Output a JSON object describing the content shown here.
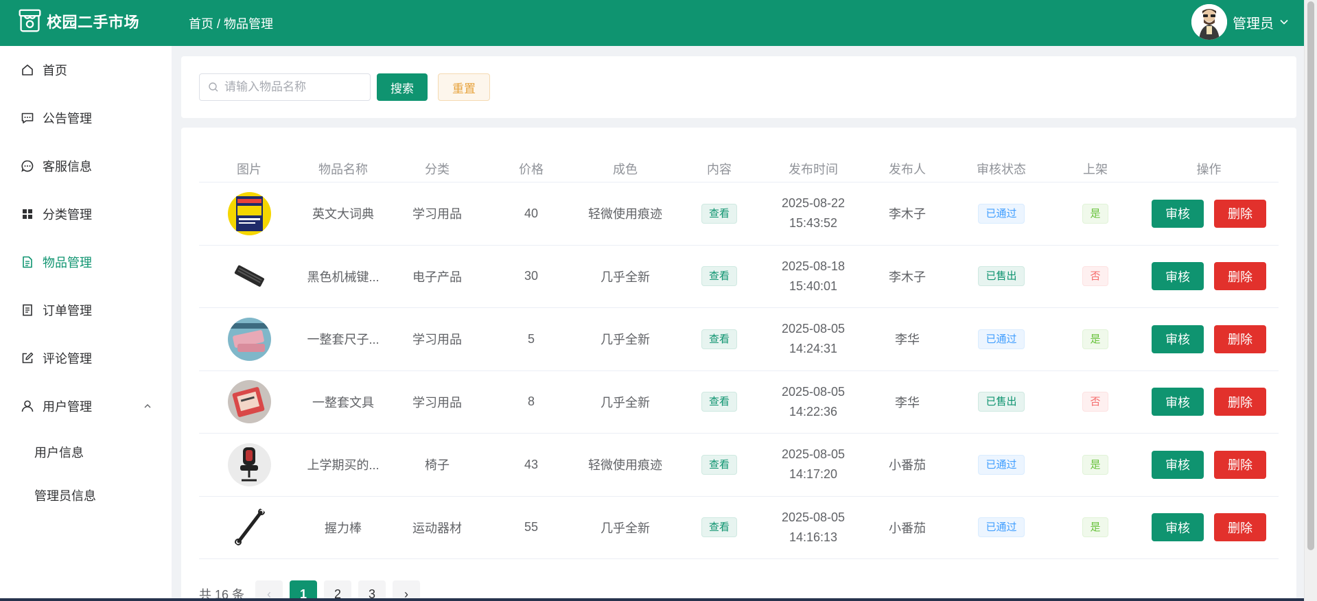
{
  "header": {
    "app_title": "校园二手市场",
    "breadcrumb": "首页 / 物品管理",
    "user_name": "管理员"
  },
  "sidebar": {
    "items": [
      {
        "label": "首页",
        "icon": "home-icon"
      },
      {
        "label": "公告管理",
        "icon": "chat-square-icon"
      },
      {
        "label": "客服信息",
        "icon": "chat-round-icon"
      },
      {
        "label": "分类管理",
        "icon": "grid-icon"
      },
      {
        "label": "物品管理",
        "icon": "document-icon",
        "active": true
      },
      {
        "label": "订单管理",
        "icon": "list-doc-icon"
      },
      {
        "label": "评论管理",
        "icon": "edit-icon"
      },
      {
        "label": "用户管理",
        "icon": "user-icon",
        "expanded": true
      }
    ],
    "sub_items": [
      "用户信息",
      "管理员信息"
    ]
  },
  "search": {
    "placeholder": "请输入物品名称",
    "search_label": "搜索",
    "reset_label": "重置"
  },
  "table": {
    "columns": [
      "图片",
      "物品名称",
      "分类",
      "价格",
      "成色",
      "内容",
      "发布时间",
      "发布人",
      "审核状态",
      "上架",
      "操作"
    ],
    "view_label": "查看",
    "audit_label": "审核",
    "delete_label": "删除",
    "rows": [
      {
        "name": "英文大词典",
        "category": "学习用品",
        "price": "40",
        "condition": "轻微使用痕迹",
        "date": "2025-08-22",
        "time": "15:43:52",
        "publisher": "李木子",
        "status": "已通过",
        "listed": "是"
      },
      {
        "name": "黑色机械键...",
        "category": "电子产品",
        "price": "30",
        "condition": "几乎全新",
        "date": "2025-08-18",
        "time": "15:40:01",
        "publisher": "李木子",
        "status": "已售出",
        "listed": "否"
      },
      {
        "name": "一整套尺子...",
        "category": "学习用品",
        "price": "5",
        "condition": "几乎全新",
        "date": "2025-08-05",
        "time": "14:24:31",
        "publisher": "李华",
        "status": "已通过",
        "listed": "是"
      },
      {
        "name": "一整套文具",
        "category": "学习用品",
        "price": "8",
        "condition": "几乎全新",
        "date": "2025-08-05",
        "time": "14:22:36",
        "publisher": "李华",
        "status": "已售出",
        "listed": "否"
      },
      {
        "name": "上学期买的...",
        "category": "椅子",
        "price": "43",
        "condition": "轻微使用痕迹",
        "date": "2025-08-05",
        "time": "14:17:20",
        "publisher": "小番茄",
        "status": "已通过",
        "listed": "是"
      },
      {
        "name": "握力棒",
        "category": "运动器材",
        "price": "55",
        "condition": "几乎全新",
        "date": "2025-08-05",
        "time": "14:16:13",
        "publisher": "小番茄",
        "status": "已通过",
        "listed": "是"
      }
    ]
  },
  "pagination": {
    "total_label": "共 16 条",
    "prev": "‹",
    "pages": [
      "1",
      "2",
      "3"
    ],
    "current_page": "1",
    "next": "›"
  },
  "colors": {
    "primary": "#0f9470",
    "danger": "#e2312c",
    "warning": "#e6a23c",
    "info": "#409eff"
  }
}
